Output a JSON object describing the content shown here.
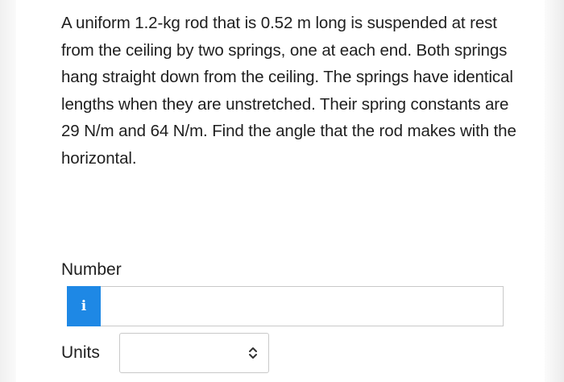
{
  "question": {
    "text": "A uniform 1.2-kg rod that is 0.52 m long is suspended at rest from the ceiling by two springs, one at each end. Both springs hang straight down from the ceiling. The springs have identical lengths when they are unstretched. Their spring constants are 29 N/m and 64 N/m. Find the angle that the rod makes with the horizontal."
  },
  "number_field": {
    "label": "Number",
    "value": "",
    "info_icon": "info-icon",
    "info_glyph": "i",
    "accent_color": "#1e88e5"
  },
  "units_field": {
    "label": "Units",
    "selected": "",
    "icon": "chevron-up-down-icon"
  }
}
